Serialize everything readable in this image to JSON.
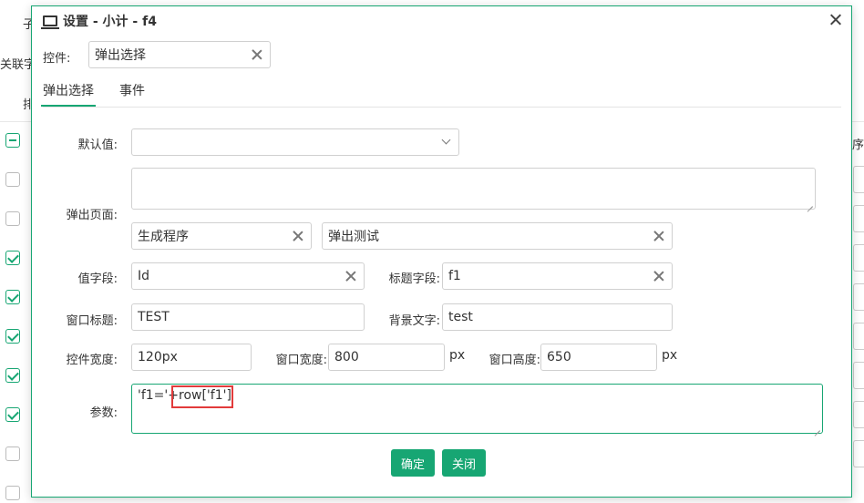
{
  "background": {
    "label_top": "子",
    "label_related": "关联字",
    "label_sort": "排",
    "label_right": "序"
  },
  "dialog": {
    "title": "设置 - 小计 - f4",
    "control_label": "控件:",
    "control_value": "弹出选择",
    "tabs": [
      {
        "label": "弹出选择",
        "active": true
      },
      {
        "label": "事件",
        "active": false
      }
    ]
  },
  "form": {
    "default_label": "默认值:",
    "default_value": "",
    "popup_page_label": "弹出页面:",
    "popup_page_value1": "生成程序",
    "popup_page_value2": "弹出测试",
    "value_field_label": "值字段:",
    "value_field_value": "Id",
    "title_field_label": "标题字段:",
    "title_field_value": "f1",
    "window_title_label": "窗口标题:",
    "window_title_value": "TEST",
    "bg_text_label": "背景文字:",
    "bg_text_value": "test",
    "ctrl_width_label": "控件宽度:",
    "ctrl_width_value": "120px",
    "win_width_label": "窗口宽度:",
    "win_width_value": "800",
    "win_width_unit": "px",
    "win_height_label": "窗口高度:",
    "win_height_value": "650",
    "win_height_unit": "px",
    "params_label": "参数:",
    "params_value": "'f1='+row['f1']"
  },
  "buttons": {
    "confirm": "确定",
    "close": "关闭"
  },
  "colors": {
    "accent": "#17a673",
    "highlight": "#e23b3b"
  }
}
